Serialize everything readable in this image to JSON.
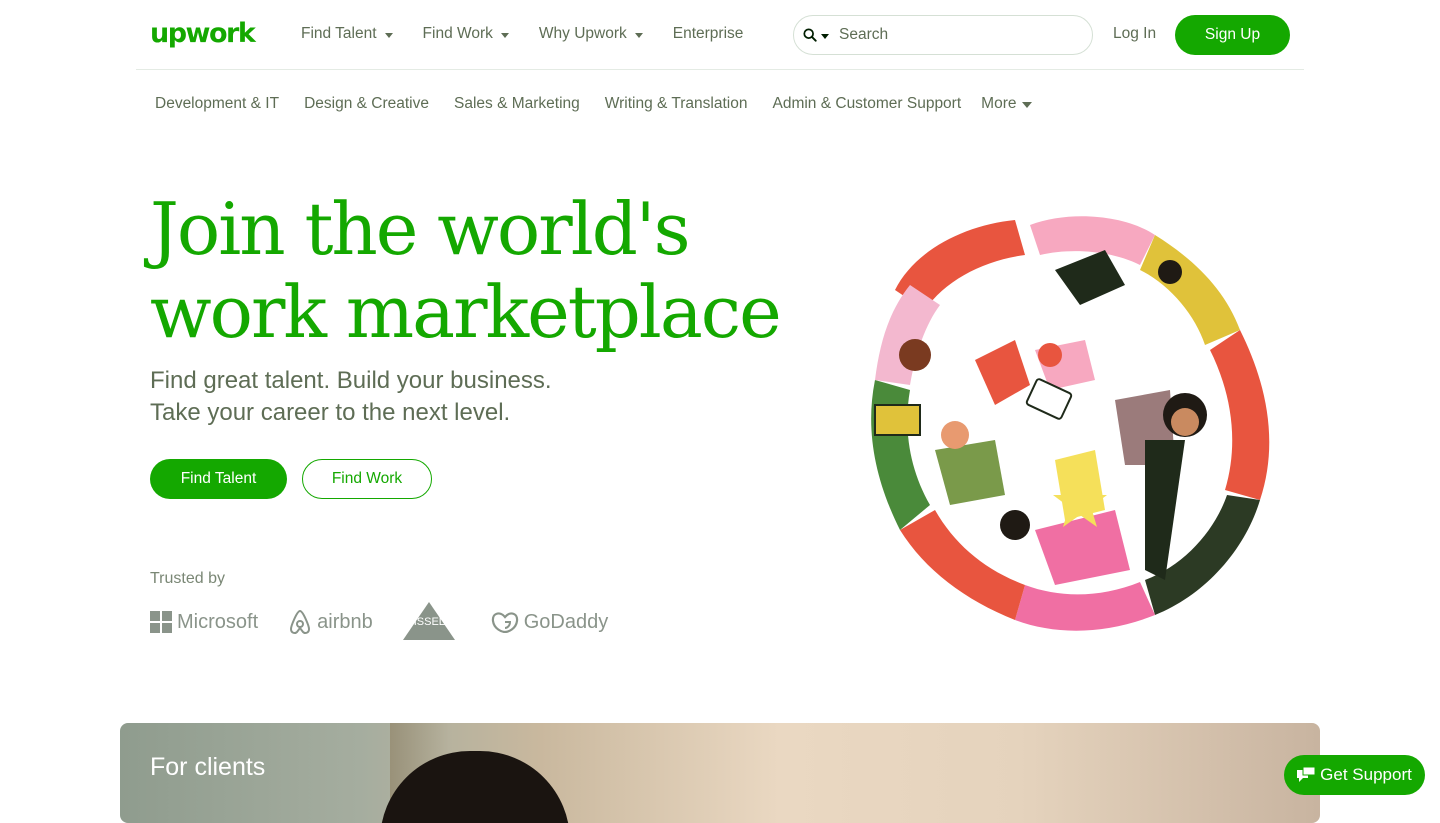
{
  "header": {
    "logo": "upwork",
    "nav": [
      {
        "label": "Find Talent",
        "has_dropdown": true
      },
      {
        "label": "Find Work",
        "has_dropdown": true
      },
      {
        "label": "Why Upwork",
        "has_dropdown": true
      },
      {
        "label": "Enterprise",
        "has_dropdown": false
      }
    ],
    "search_placeholder": "Search",
    "login": "Log In",
    "signup": "Sign Up"
  },
  "categories": {
    "items": [
      "Development & IT",
      "Design & Creative",
      "Sales & Marketing",
      "Writing & Translation",
      "Admin & Customer Support"
    ],
    "more": "More"
  },
  "hero": {
    "title_line1": "Join the world's",
    "title_line2": "work marketplace",
    "subtitle_line1": "Find great talent. Build your business.",
    "subtitle_line2": "Take your career to the next level.",
    "find_talent": "Find Talent",
    "find_work": "Find Work"
  },
  "trusted": {
    "label": "Trusted by",
    "brands": [
      "Microsoft",
      "airbnb",
      "BISSELL",
      "GoDaddy"
    ]
  },
  "clients_section": {
    "label": "For clients"
  },
  "support_button": "Get Support",
  "colors": {
    "brand_green": "#14a800",
    "text_gray": "#5e6d55"
  }
}
